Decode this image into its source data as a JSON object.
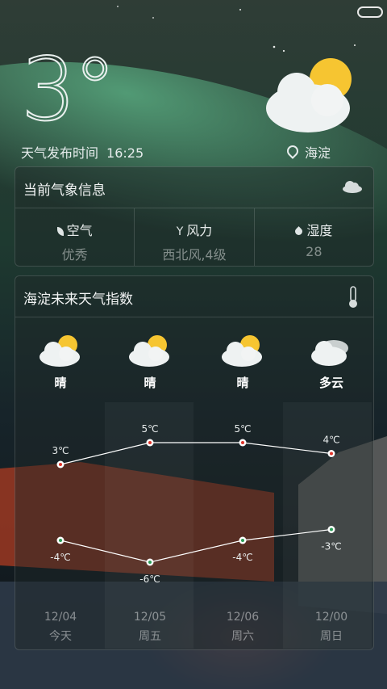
{
  "current": {
    "temperature": "3°",
    "publish_label": "天气发布时间",
    "publish_time": "16:25",
    "location": "海淀"
  },
  "info_card": {
    "title": "当前气象信息",
    "items": [
      {
        "label": "空气",
        "value": "优秀",
        "icon": "leaf-icon"
      },
      {
        "label": "风力",
        "value": "西北风,4级",
        "icon": "wind-icon"
      },
      {
        "label": "湿度",
        "value": "28",
        "icon": "drop-icon"
      }
    ]
  },
  "forecast_card": {
    "title": "海淀未来天气指数",
    "days": [
      {
        "weather": "晴",
        "icon": "sunny-cloud-icon",
        "high": 3,
        "low": -4,
        "high_label": "3℃",
        "low_label": "-4℃",
        "date": "12/04",
        "day": "今天"
      },
      {
        "weather": "晴",
        "icon": "sunny-cloud-icon",
        "high": 5,
        "low": -6,
        "high_label": "5℃",
        "low_label": "-6℃",
        "date": "12/05",
        "day": "周五"
      },
      {
        "weather": "晴",
        "icon": "sunny-cloud-icon",
        "high": 5,
        "low": -4,
        "high_label": "5℃",
        "low_label": "-4℃",
        "date": "12/06",
        "day": "周六"
      },
      {
        "weather": "多云",
        "icon": "cloudy-icon",
        "high": 4,
        "low": -3,
        "high_label": "4℃",
        "low_label": "-3℃",
        "date": "12/00",
        "day": "周日"
      }
    ]
  },
  "colors": {
    "high_dot": "#e0342a",
    "low_dot": "#2a9d57",
    "line": "#ffffff"
  }
}
